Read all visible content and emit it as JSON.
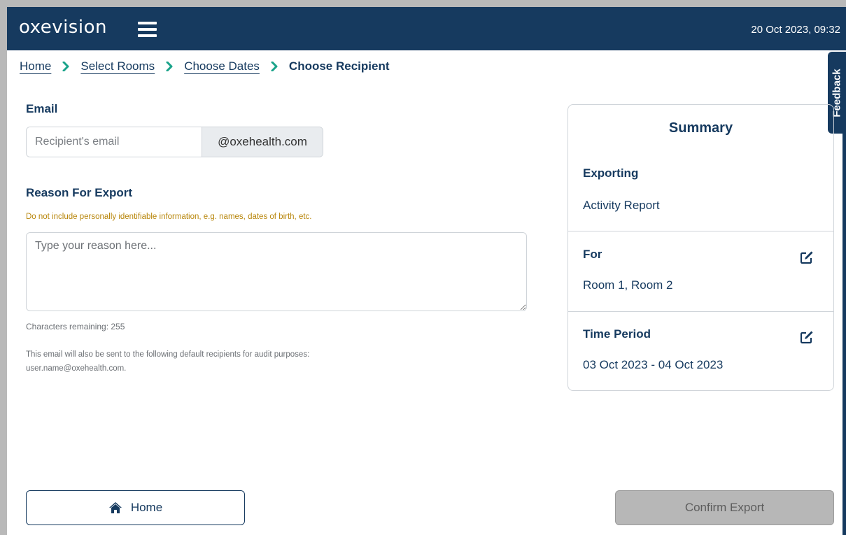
{
  "header": {
    "logo": "oxevision",
    "datetime": "20 Oct 2023, 09:32"
  },
  "breadcrumb": {
    "items": [
      {
        "label": "Home"
      },
      {
        "label": "Select Rooms"
      },
      {
        "label": "Choose Dates"
      },
      {
        "label": "Choose Recipient"
      }
    ]
  },
  "feedback": {
    "label": "Feedback"
  },
  "email": {
    "label": "Email",
    "placeholder": "Recipient's email",
    "suffix": "@oxehealth.com"
  },
  "reason": {
    "label": "Reason For Export",
    "warning": "Do not include personally identifiable information, e.g. names, dates of birth, etc.",
    "placeholder": "Type your reason here...",
    "chars_remaining": "Characters remaining: 255",
    "audit_note_line1": "This email will also be sent to the following default recipients for audit purposes:",
    "audit_note_line2": "user.name@oxehealth.com."
  },
  "summary": {
    "title": "Summary",
    "exporting_label": "Exporting",
    "exporting_value": "Activity Report",
    "for_label": "For",
    "for_value": "Room 1, Room 2",
    "period_label": "Time Period",
    "period_value": "03 Oct 2023 - 04 Oct 2023"
  },
  "footer": {
    "home_label": "Home",
    "confirm_label": "Confirm Export"
  },
  "colors": {
    "navy": "#163a5f",
    "teal_chevron": "#1aa38a",
    "warning": "#b8860b",
    "disabled_button": "#b7b7b7"
  },
  "icons": {
    "menu": "hamburger-icon",
    "breadcrumb_separator": "chevron-right-icon",
    "edit": "edit-icon",
    "home": "home-icon"
  }
}
